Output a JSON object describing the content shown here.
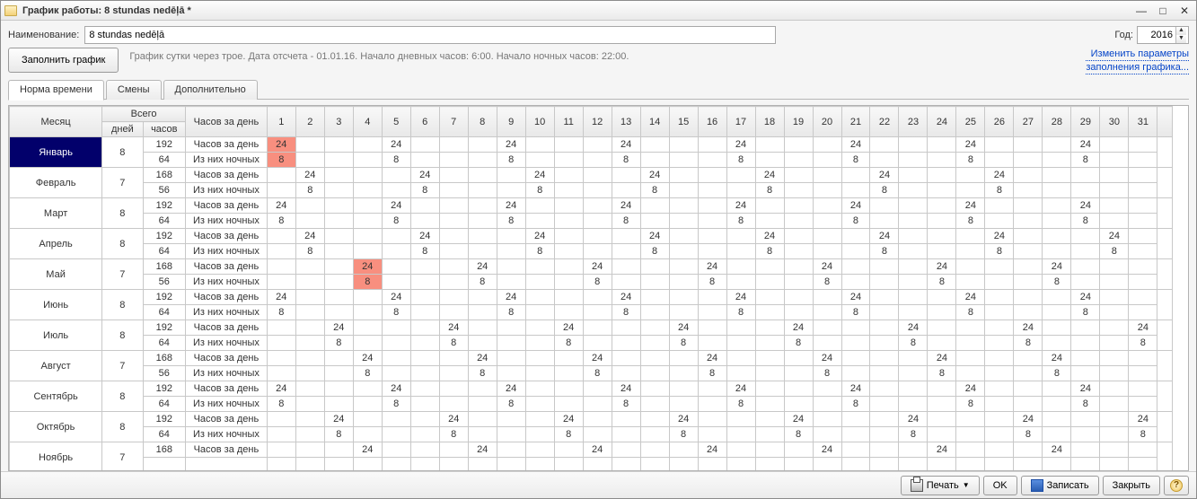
{
  "window": {
    "title": "График работы: 8 stundas nedēļā *"
  },
  "fields": {
    "name_label": "Наименование:",
    "name_value": "8 stundas nedēļā",
    "year_label": "Год:",
    "year_value": "2016"
  },
  "actions": {
    "fill_schedule": "Заполнить график",
    "description": "График сутки через трое. Дата отсчета - 01.01.16. Начало дневных часов: 6:00. Начало ночных часов: 22:00.",
    "change_params_line1": "Изменить параметры",
    "change_params_line2": "заполнения графика..."
  },
  "tabs": {
    "t1": "Норма времени",
    "t2": "Смены",
    "t3": "Дополнительно"
  },
  "headers": {
    "month": "Месяц",
    "total": "Всего",
    "hours_per_day": "Часов за день",
    "days": "дней",
    "hours": "часов"
  },
  "row_labels": {
    "hpd": "Часов за день",
    "night": "Из них ночных"
  },
  "footer": {
    "print": "Печать",
    "ok": "OK",
    "save": "Записать",
    "close": "Закрыть"
  },
  "months": [
    {
      "name": "Январь",
      "days": 8,
      "hours": 192,
      "hours2": 64,
      "selected": true,
      "hpd": {
        "1": {
          "v": 24,
          "h": true
        },
        "5": {
          "v": 24
        },
        "9": {
          "v": 24
        },
        "13": {
          "v": 24
        },
        "17": {
          "v": 24
        },
        "21": {
          "v": 24
        },
        "25": {
          "v": 24
        },
        "29": {
          "v": 24
        }
      },
      "night": {
        "1": {
          "v": 8,
          "h": true
        },
        "5": {
          "v": 8
        },
        "9": {
          "v": 8
        },
        "13": {
          "v": 8
        },
        "17": {
          "v": 8
        },
        "21": {
          "v": 8
        },
        "25": {
          "v": 8
        },
        "29": {
          "v": 8
        }
      },
      "soft": [
        2,
        3,
        4,
        6,
        7,
        8,
        10,
        11,
        12,
        14,
        15,
        16,
        18,
        19,
        20,
        22,
        23,
        24,
        26,
        27,
        28,
        30,
        31
      ]
    },
    {
      "name": "Февраль",
      "days": 7,
      "hours": 168,
      "hours2": 56,
      "hpd": {
        "2": {
          "v": 24
        },
        "6": {
          "v": 24
        },
        "10": {
          "v": 24
        },
        "14": {
          "v": 24
        },
        "18": {
          "v": 24
        },
        "22": {
          "v": 24
        },
        "26": {
          "v": 24
        }
      },
      "night": {
        "2": {
          "v": 8
        },
        "6": {
          "v": 8
        },
        "10": {
          "v": 8
        },
        "14": {
          "v": 8
        },
        "18": {
          "v": 8
        },
        "22": {
          "v": 8
        },
        "26": {
          "v": 8
        }
      },
      "soft": [
        1,
        3,
        4,
        5,
        7,
        8,
        9,
        11,
        12,
        13,
        15,
        16,
        17,
        19,
        20,
        21,
        23,
        24,
        25,
        27,
        28,
        29
      ]
    },
    {
      "name": "Март",
      "days": 8,
      "hours": 192,
      "hours2": 64,
      "hpd": {
        "1": {
          "v": 24
        },
        "5": {
          "v": 24
        },
        "9": {
          "v": 24
        },
        "13": {
          "v": 24
        },
        "17": {
          "v": 24
        },
        "21": {
          "v": 24
        },
        "25": {
          "v": 24
        },
        "29": {
          "v": 24
        }
      },
      "night": {
        "1": {
          "v": 8
        },
        "5": {
          "v": 8
        },
        "9": {
          "v": 8
        },
        "13": {
          "v": 8
        },
        "17": {
          "v": 8
        },
        "21": {
          "v": 8
        },
        "25": {
          "v": 8
        },
        "29": {
          "v": 8
        }
      },
      "soft": [
        2,
        3,
        4,
        6,
        7,
        8,
        10,
        11,
        12,
        14,
        15,
        16,
        18,
        19,
        20,
        22,
        23,
        24,
        26,
        27,
        28,
        30,
        31
      ]
    },
    {
      "name": "Апрель",
      "days": 8,
      "hours": 192,
      "hours2": 64,
      "hpd": {
        "2": {
          "v": 24
        },
        "6": {
          "v": 24
        },
        "10": {
          "v": 24
        },
        "14": {
          "v": 24
        },
        "18": {
          "v": 24
        },
        "22": {
          "v": 24
        },
        "26": {
          "v": 24
        },
        "30": {
          "v": 24
        }
      },
      "night": {
        "2": {
          "v": 8
        },
        "6": {
          "v": 8
        },
        "10": {
          "v": 8
        },
        "14": {
          "v": 8
        },
        "18": {
          "v": 8
        },
        "22": {
          "v": 8
        },
        "26": {
          "v": 8
        },
        "30": {
          "v": 8
        }
      },
      "soft": [
        1,
        3,
        4,
        5,
        7,
        8,
        9,
        11,
        12,
        13,
        15,
        16,
        17,
        19,
        20,
        21,
        23,
        24,
        25,
        27,
        28,
        29,
        31
      ]
    },
    {
      "name": "Май",
      "days": 7,
      "hours": 168,
      "hours2": 56,
      "hpd": {
        "4": {
          "v": 24,
          "h": true
        },
        "8": {
          "v": 24
        },
        "12": {
          "v": 24
        },
        "16": {
          "v": 24
        },
        "20": {
          "v": 24
        },
        "24": {
          "v": 24
        },
        "28": {
          "v": 24
        }
      },
      "night": {
        "4": {
          "v": 8,
          "h": true
        },
        "8": {
          "v": 8
        },
        "12": {
          "v": 8
        },
        "16": {
          "v": 8
        },
        "20": {
          "v": 8
        },
        "24": {
          "v": 8
        },
        "28": {
          "v": 8
        }
      },
      "soft": [
        2,
        3,
        5,
        6,
        7,
        9,
        10,
        11,
        13,
        14,
        15,
        17,
        18,
        19,
        21,
        22,
        23,
        25,
        26,
        27,
        29,
        30,
        31
      ],
      "hard": [
        1
      ]
    },
    {
      "name": "Июнь",
      "days": 8,
      "hours": 192,
      "hours2": 64,
      "hpd": {
        "1": {
          "v": 24
        },
        "5": {
          "v": 24
        },
        "9": {
          "v": 24
        },
        "13": {
          "v": 24
        },
        "17": {
          "v": 24
        },
        "21": {
          "v": 24
        },
        "25": {
          "v": 24
        },
        "29": {
          "v": 24
        }
      },
      "night": {
        "1": {
          "v": 8
        },
        "5": {
          "v": 8
        },
        "9": {
          "v": 8
        },
        "13": {
          "v": 8
        },
        "17": {
          "v": 8
        },
        "21": {
          "v": 8
        },
        "25": {
          "v": 8
        },
        "29": {
          "v": 8
        }
      },
      "soft": [
        2,
        3,
        4,
        6,
        7,
        8,
        10,
        11,
        12,
        14,
        15,
        16,
        18,
        19,
        20,
        22,
        26,
        27,
        28,
        30,
        31
      ],
      "hard": [
        23,
        24
      ]
    },
    {
      "name": "Июль",
      "days": 8,
      "hours": 192,
      "hours2": 64,
      "hpd": {
        "3": {
          "v": 24
        },
        "7": {
          "v": 24
        },
        "11": {
          "v": 24
        },
        "15": {
          "v": 24
        },
        "19": {
          "v": 24
        },
        "23": {
          "v": 24
        },
        "27": {
          "v": 24
        },
        "31": {
          "v": 24
        }
      },
      "night": {
        "3": {
          "v": 8
        },
        "7": {
          "v": 8
        },
        "11": {
          "v": 8
        },
        "15": {
          "v": 8
        },
        "19": {
          "v": 8
        },
        "23": {
          "v": 8
        },
        "27": {
          "v": 8
        },
        "31": {
          "v": 8
        }
      },
      "soft": [
        1,
        2,
        4,
        5,
        6,
        8,
        9,
        10,
        12,
        13,
        14,
        16,
        17,
        18,
        20,
        21,
        22,
        24,
        25,
        26,
        28,
        29,
        30
      ]
    },
    {
      "name": "Август",
      "days": 7,
      "hours": 168,
      "hours2": 56,
      "hpd": {
        "4": {
          "v": 24
        },
        "8": {
          "v": 24
        },
        "12": {
          "v": 24
        },
        "16": {
          "v": 24
        },
        "20": {
          "v": 24
        },
        "24": {
          "v": 24
        },
        "28": {
          "v": 24
        }
      },
      "night": {
        "4": {
          "v": 8
        },
        "8": {
          "v": 8
        },
        "12": {
          "v": 8
        },
        "16": {
          "v": 8
        },
        "20": {
          "v": 8
        },
        "24": {
          "v": 8
        },
        "28": {
          "v": 8
        }
      },
      "soft": [
        1,
        2,
        3,
        5,
        6,
        7,
        9,
        10,
        11,
        13,
        14,
        15,
        17,
        18,
        19,
        21,
        22,
        23,
        25,
        26,
        27,
        29,
        30,
        31
      ]
    },
    {
      "name": "Сентябрь",
      "days": 8,
      "hours": 192,
      "hours2": 64,
      "hpd": {
        "1": {
          "v": 24
        },
        "5": {
          "v": 24
        },
        "9": {
          "v": 24
        },
        "13": {
          "v": 24
        },
        "17": {
          "v": 24
        },
        "21": {
          "v": 24
        },
        "25": {
          "v": 24
        },
        "29": {
          "v": 24
        }
      },
      "night": {
        "1": {
          "v": 8
        },
        "5": {
          "v": 8
        },
        "9": {
          "v": 8
        },
        "13": {
          "v": 8
        },
        "17": {
          "v": 8
        },
        "21": {
          "v": 8
        },
        "25": {
          "v": 8
        },
        "29": {
          "v": 8
        }
      },
      "soft": [
        2,
        3,
        4,
        6,
        7,
        8,
        10,
        11,
        12,
        14,
        15,
        16,
        18,
        19,
        20,
        22,
        23,
        24,
        26,
        27,
        28,
        30,
        31
      ]
    },
    {
      "name": "Октябрь",
      "days": 8,
      "hours": 192,
      "hours2": 64,
      "hpd": {
        "3": {
          "v": 24
        },
        "7": {
          "v": 24
        },
        "11": {
          "v": 24
        },
        "15": {
          "v": 24
        },
        "19": {
          "v": 24
        },
        "23": {
          "v": 24
        },
        "27": {
          "v": 24
        },
        "31": {
          "v": 24
        }
      },
      "night": {
        "3": {
          "v": 8
        },
        "7": {
          "v": 8
        },
        "11": {
          "v": 8
        },
        "15": {
          "v": 8
        },
        "19": {
          "v": 8
        },
        "23": {
          "v": 8
        },
        "27": {
          "v": 8
        },
        "31": {
          "v": 8
        }
      },
      "soft": [
        1,
        2,
        4,
        5,
        6,
        8,
        9,
        10,
        12,
        13,
        14,
        16,
        17,
        20,
        21,
        22,
        24,
        25,
        26,
        28,
        29,
        30
      ],
      "hard": [
        18
      ]
    },
    {
      "name": "Ноябрь",
      "days": 7,
      "hours": 168,
      "hours2": "",
      "hpd": {
        "4": {
          "v": 24
        },
        "8": {
          "v": 24
        },
        "12": {
          "v": 24
        },
        "16": {
          "v": 24
        },
        "20": {
          "v": 24
        },
        "24": {
          "v": 24
        },
        "28": {
          "v": 24
        }
      },
      "night": {},
      "soft": [
        1,
        2,
        3,
        5,
        6,
        7,
        9,
        10,
        11,
        13,
        14,
        15,
        17,
        19,
        21,
        22,
        23,
        25,
        26,
        27,
        29,
        30,
        31
      ],
      "hideSecond": true
    }
  ]
}
